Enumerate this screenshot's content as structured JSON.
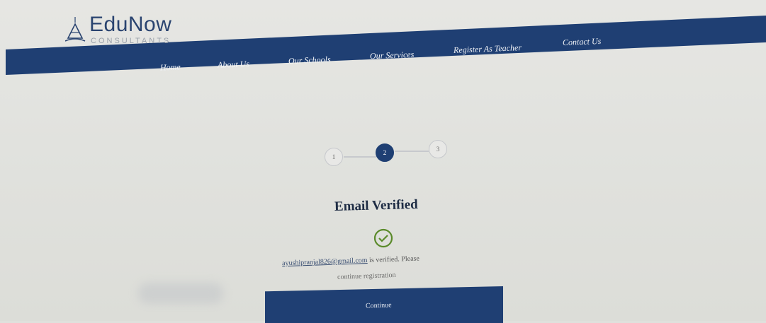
{
  "brand": {
    "name": "EduNow",
    "tagline": "CONSULTANTS"
  },
  "nav": {
    "items": [
      {
        "label": "Home"
      },
      {
        "label": "About Us"
      },
      {
        "label": "Our Schools"
      },
      {
        "label": "Our Services"
      },
      {
        "label": "Register As Teacher"
      },
      {
        "label": "Contact Us"
      }
    ]
  },
  "stepper": {
    "steps": [
      "1",
      "2",
      "3"
    ],
    "active_step": 2
  },
  "verification": {
    "title": "Email Verified",
    "email": "ayushipranjal826@gmail.com",
    "message_part1": " is verified. Please",
    "message_part2": "continue registration"
  },
  "continue_button": {
    "label": "Continue"
  },
  "colors": {
    "brand": "#1f3f73",
    "success": "#5a8a2a",
    "background": "#e1e2de"
  }
}
